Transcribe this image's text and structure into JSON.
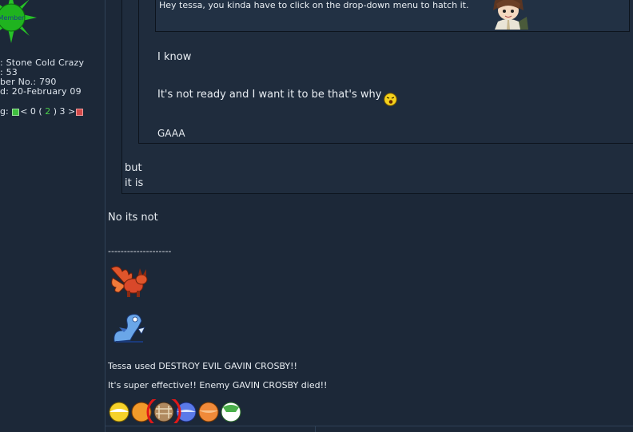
{
  "sidebar": {
    "badge_label": "Member",
    "info": [
      ": Stone Cold Crazy",
      ": 53",
      "ber No.: 790",
      "d: 20-February 09"
    ],
    "gauge_prefix": "g:",
    "gauge_left": "< 0 (",
    "gauge_mid": "2",
    "gauge_right": ") 3 >"
  },
  "post": {
    "innermost_quote": "Hey tessa, you kinda have to click on the drop-down menu to hatch it.",
    "mid_quote_lines": [
      "I know",
      "It's not ready and I want it to be that's why",
      "GAAA"
    ],
    "outer_quote_lines": [
      "but",
      "it is"
    ],
    "reply": "No its not",
    "separator": "--------------------",
    "signature_line1": "Tessa used DESTROY EVIL GAVIN CROSBY!!",
    "signature_line2": "It's super effective!! Enemy GAVIN CROSBY died!!"
  },
  "colors": {
    "background": "#1c2838",
    "quote_bg": "#1f2c3d",
    "text": "#e8edf2",
    "highlight_circle": "#e01818"
  },
  "icons": {
    "badge": "green-sun-badge-icon",
    "avatar": "anime-character-avatar",
    "smiley": "laughing-smiley-icon",
    "sprite1": "vulpix-sprite",
    "sprite2": "dratini-sprite",
    "eggs": "pokemon-egg-icons"
  }
}
